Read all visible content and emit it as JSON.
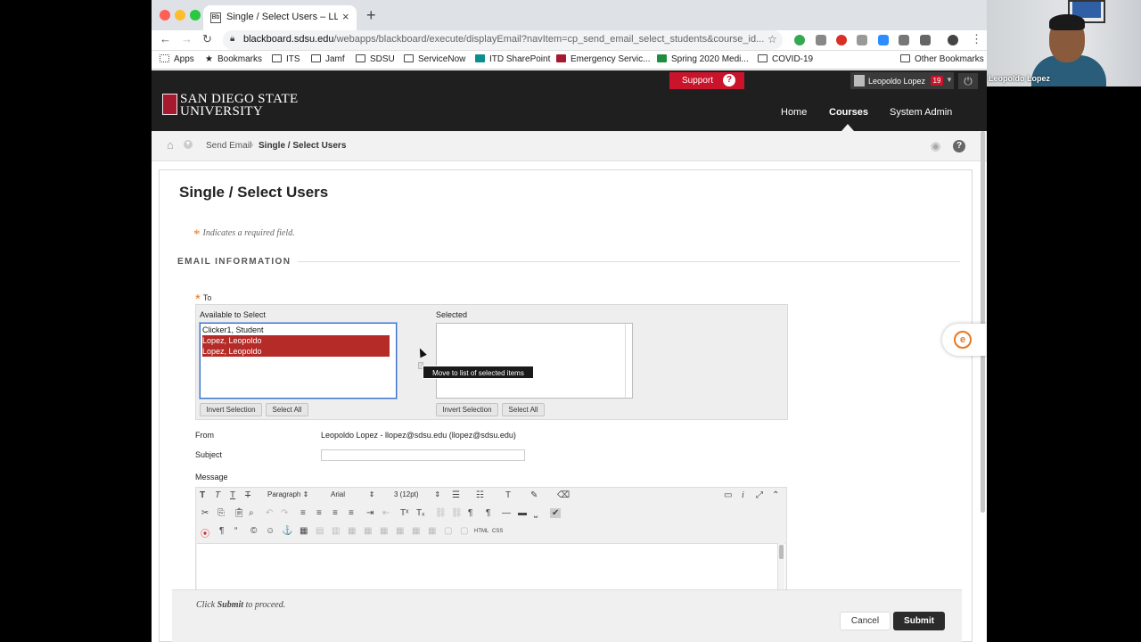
{
  "tab": {
    "title": "Single / Select Users – LLopez"
  },
  "address": {
    "domain": "blackboard.sdsu.edu",
    "path": "/webapps/blackboard/execute/displayEmail?navItem=cp_send_email_select_students&course_id..."
  },
  "bookmarks": [
    "Apps",
    "Bookmarks",
    "ITS",
    "Jamf",
    "SDSU",
    "ServiceNow",
    "ITD SharePoint",
    "Emergency Servic...",
    "Spring 2020 Medi...",
    "COVID-19",
    "Other Bookmarks"
  ],
  "header": {
    "logo_line1": "San Diego State",
    "logo_line2": "University",
    "support_label": "Support",
    "user_name": "Leopoldo Lopez",
    "notification_count": "19",
    "nav": [
      "Home",
      "Courses",
      "System Admin"
    ]
  },
  "breadcrumb": {
    "item1": "Send Email",
    "item2": "Single / Select Users"
  },
  "page": {
    "title": "Single / Select Users",
    "required_note": "Indicates a required field.",
    "section_heading": "EMAIL INFORMATION",
    "to_label": "To",
    "available_label": "Available to Select",
    "selected_label": "Selected",
    "available_options": [
      {
        "label": "Clicker1, Student"
      },
      {
        "label": "Lopez, Leopoldo"
      },
      {
        "label": "Lopez, Leopoldo"
      }
    ],
    "invert_selection": "Invert Selection",
    "select_all": "Select All",
    "tooltip": "Move to list of selected items",
    "from_label": "From",
    "from_value": "Leopoldo Lopez - llopez@sdsu.edu (llopez@sdsu.edu)",
    "subject_label": "Subject",
    "message_label": "Message",
    "editor": {
      "format": "Paragraph",
      "font": "Arial",
      "size": "3 (12pt)",
      "html_label": "HTML",
      "css_label": "CSS"
    }
  },
  "footer": {
    "note_pre": "Click ",
    "note_bold": "Submit",
    "note_post": " to proceed.",
    "cancel": "Cancel",
    "submit": "Submit"
  },
  "webcam": {
    "name": "Leopoldo Lopez"
  },
  "colors": {
    "accent_red": "#c9142b",
    "selection_red": "#b42b28",
    "header_dark": "#1f1f1f"
  }
}
